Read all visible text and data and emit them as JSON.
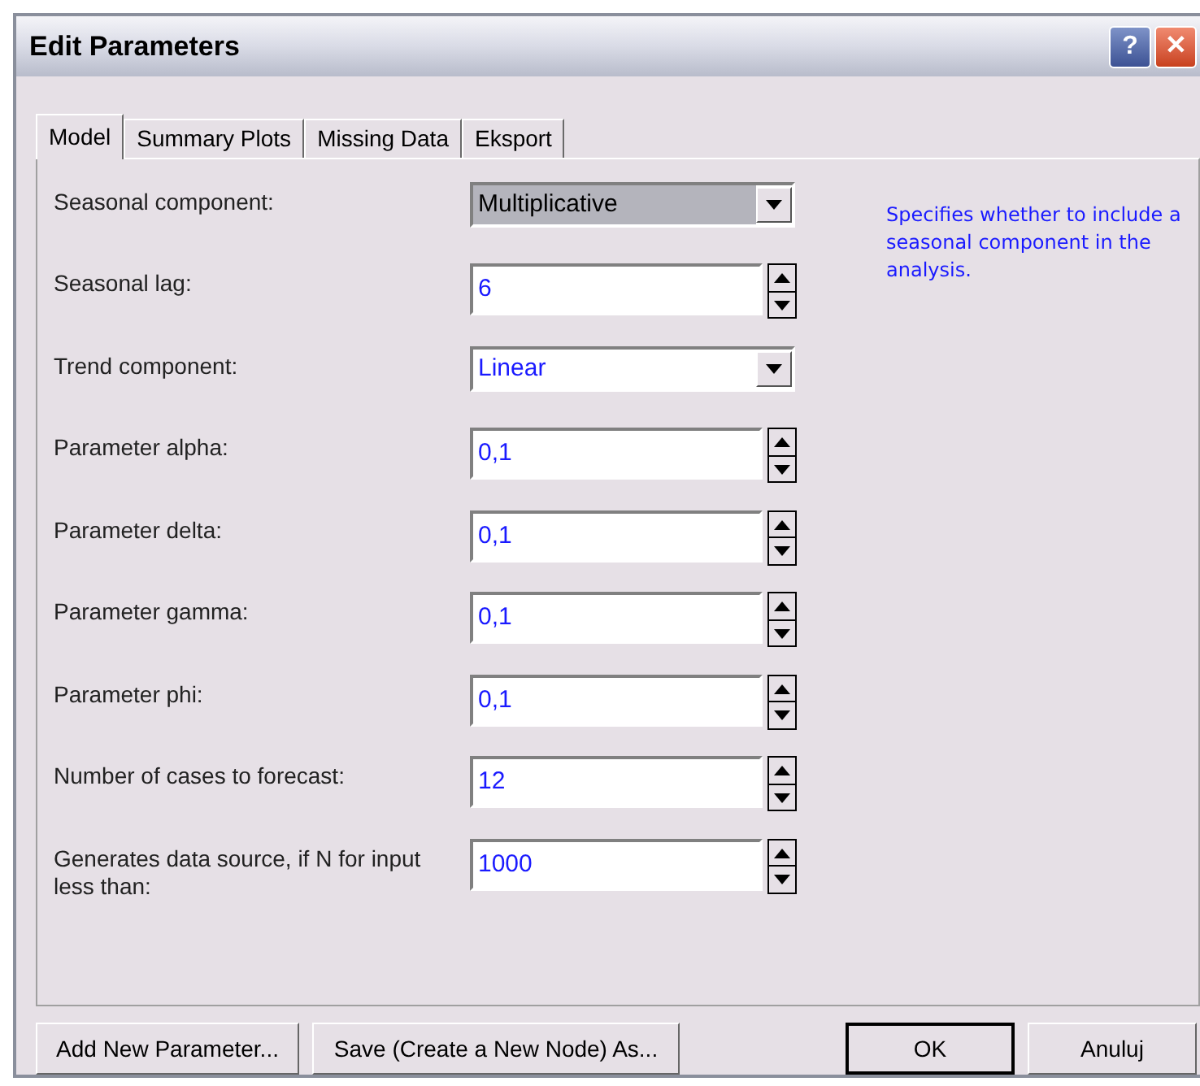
{
  "window": {
    "title": "Edit Parameters",
    "controls": [
      "?",
      "✕"
    ]
  },
  "tabs": [
    {
      "label": "Model",
      "selected": true
    },
    {
      "label": "Summary Plots",
      "selected": false
    },
    {
      "label": "Missing Data",
      "selected": false
    },
    {
      "label": "Eksport",
      "selected": false
    }
  ],
  "fields": [
    {
      "label": "Seasonal component:",
      "kind": "dropdown",
      "value": "Multiplicative",
      "focused": true
    },
    {
      "label": "Seasonal lag:",
      "kind": "spinner",
      "value": "6",
      "focused": false
    },
    {
      "label": "Trend component:",
      "kind": "dropdown",
      "value": "Linear",
      "focused": false
    },
    {
      "label": "Parameter alpha:",
      "kind": "spinner",
      "value": "0,1",
      "focused": false
    },
    {
      "label": "Parameter delta:",
      "kind": "spinner",
      "value": "0,1",
      "focused": false
    },
    {
      "label": "Parameter gamma:",
      "kind": "spinner",
      "value": "0,1",
      "focused": false
    },
    {
      "label": "Parameter phi:",
      "kind": "spinner",
      "value": "0,1",
      "focused": false
    },
    {
      "label": "Number of cases to forecast:",
      "kind": "spinner",
      "value": "12",
      "focused": false
    },
    {
      "label": "Generates data source, if N for input less than:",
      "kind": "spinner",
      "value": "1000",
      "focused": false
    }
  ],
  "help_text": "Specifies whether to include a seasonal component in the analysis.",
  "buttons": [
    {
      "label": "Add New Parameter...",
      "default": false
    },
    {
      "label": "Save (Create a New Node) As...",
      "default": false
    },
    {
      "label": "OK",
      "default": true
    },
    {
      "label": "Anuluj",
      "default": false
    }
  ]
}
